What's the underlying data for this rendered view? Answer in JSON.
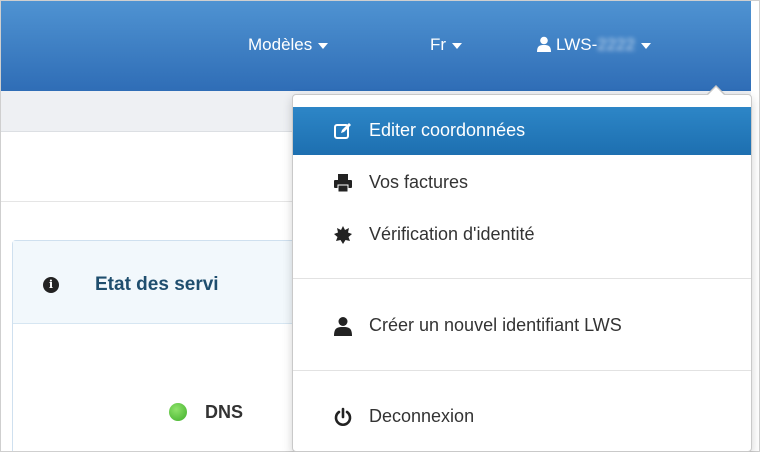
{
  "navbar": {
    "templates_label": "Modèles",
    "language_label": "Fr",
    "user_prefix": "LWS-",
    "user_suffix": "2222"
  },
  "panel": {
    "title": "Etat des servi",
    "dns_label": "DNS"
  },
  "dropdown": {
    "items": [
      {
        "label": "Editer coordonnées",
        "icon": "edit-icon"
      },
      {
        "label": "Vos factures",
        "icon": "print-icon"
      },
      {
        "label": "Vérification d'identité",
        "icon": "certificate-icon"
      },
      {
        "label": "Créer un nouvel identifiant LWS",
        "icon": "user-icon"
      },
      {
        "label": "Deconnexion",
        "icon": "power-icon"
      }
    ]
  },
  "colors": {
    "navbar": "#3a7dc4",
    "active_item": "#2079bb",
    "status_ok": "#4cbb30"
  }
}
